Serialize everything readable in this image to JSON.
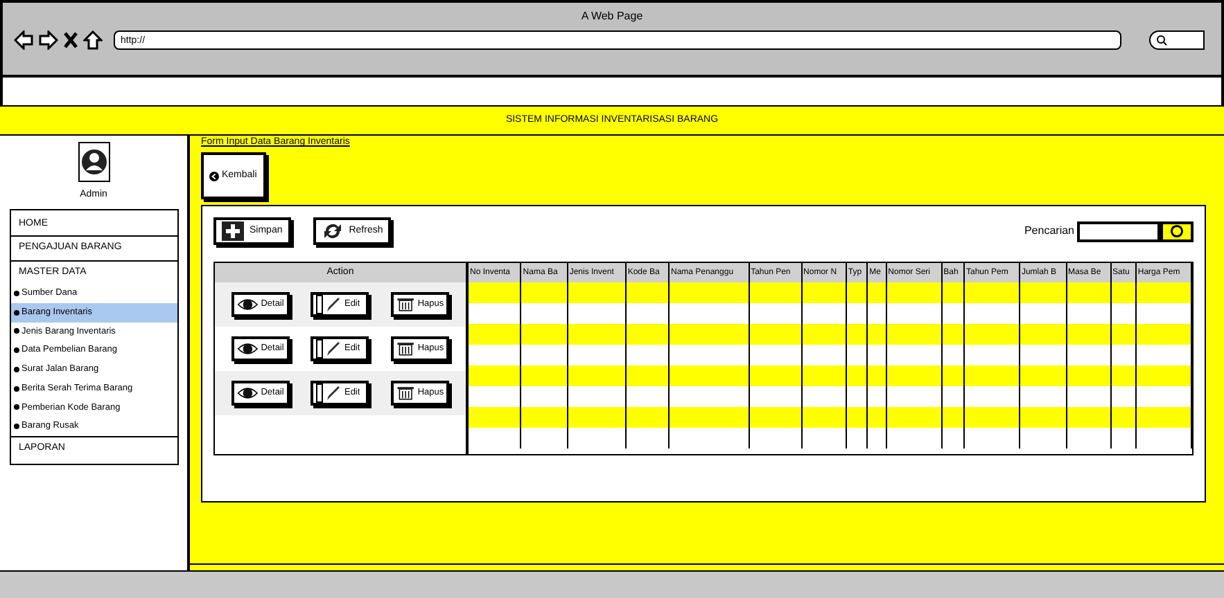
{
  "window": {
    "title": "A Web Page",
    "url": "http://"
  },
  "header": {
    "title": "SISTEM INFORMASI INVENTARISASI BARANG"
  },
  "sidebar": {
    "user": "Admin",
    "items": [
      {
        "label": "HOME",
        "kind": "section",
        "selected": false
      },
      {
        "label": "PENGAJUAN BARANG",
        "kind": "section",
        "selected": false
      },
      {
        "label": "MASTER DATA",
        "kind": "group",
        "selected": false
      },
      {
        "label": "Sumber Dana",
        "kind": "sub",
        "selected": false
      },
      {
        "label": "Barang Inventaris",
        "kind": "sub",
        "selected": true
      },
      {
        "label": "Jenis Barang Inventaris",
        "kind": "sub",
        "selected": false
      },
      {
        "label": "Data Pembelian Barang",
        "kind": "sub",
        "selected": false
      },
      {
        "label": "Surat Jalan Barang",
        "kind": "sub",
        "selected": false
      },
      {
        "label": "Berita Serah Terima Barang",
        "kind": "sub",
        "selected": false
      },
      {
        "label": "Pemberian Kode Barang",
        "kind": "sub",
        "selected": false
      },
      {
        "label": "Barang Rusak",
        "kind": "sub",
        "selected": false
      },
      {
        "label": "LAPORAN",
        "kind": "section",
        "selected": false
      }
    ]
  },
  "form": {
    "legend": "Form Input Data Barang Inventaris",
    "back_button": "Kembali",
    "save_button": "Simpan",
    "refresh_button": "Refresh",
    "search_label": "Pencarian",
    "action_panel": {
      "title": "Action",
      "rows": [
        {
          "buttons": [
            {
              "kind": "detail",
              "label": "Detail"
            },
            {
              "kind": "edit",
              "label": "Edit"
            },
            {
              "kind": "delete",
              "label": "Hapus"
            }
          ]
        },
        {
          "buttons": [
            {
              "kind": "detail",
              "label": "Detail"
            },
            {
              "kind": "edit",
              "label": "Edit"
            },
            {
              "kind": "delete",
              "label": "Hapus"
            }
          ]
        },
        {
          "buttons": [
            {
              "kind": "detail",
              "label": "Detail"
            },
            {
              "kind": "edit",
              "label": "Edit"
            },
            {
              "kind": "delete",
              "label": "Hapus"
            }
          ]
        }
      ]
    },
    "table": {
      "columns": [
        "No Inventa",
        "Nama Ba",
        "Jenis Invent",
        "Kode Ba",
        "Nama Penanggu",
        "Tahun Pen",
        "Nomor N",
        "Typ",
        "Me",
        "Nomor Seri",
        "Bah",
        "Tahun Pem",
        "Jumlah B",
        "Masa Be",
        "Satu",
        "Harga Pem"
      ]
    }
  }
}
